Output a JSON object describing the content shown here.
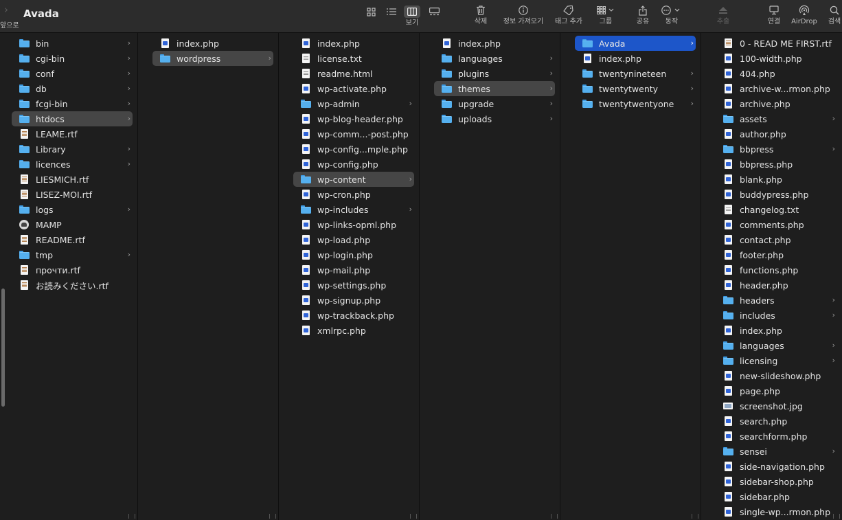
{
  "window": {
    "title": "Avada",
    "back_label": "앞으로"
  },
  "toolbar": {
    "view_label": "보기",
    "delete_label": "삭제",
    "info_label": "정보 가져오기",
    "tag_label": "태그 추가",
    "group_label": "그룹",
    "share_label": "공유",
    "action_label": "동작",
    "eject_label": "추출",
    "connect_label": "연결",
    "airdrop_label": "AirDrop",
    "search_label": "검색"
  },
  "columns": [
    {
      "items": [
        {
          "name": "bin",
          "type": "folder",
          "chevron": true
        },
        {
          "name": "cgi-bin",
          "type": "folder",
          "chevron": true
        },
        {
          "name": "conf",
          "type": "folder",
          "chevron": true
        },
        {
          "name": "db",
          "type": "folder",
          "chevron": true
        },
        {
          "name": "fcgi-bin",
          "type": "folder",
          "chevron": true
        },
        {
          "name": "htdocs",
          "type": "folder",
          "chevron": true,
          "selected": "gray"
        },
        {
          "name": "LEAME.rtf",
          "type": "rtf"
        },
        {
          "name": "Library",
          "type": "folder",
          "chevron": true
        },
        {
          "name": "licences",
          "type": "folder",
          "chevron": true
        },
        {
          "name": "LIESMICH.rtf",
          "type": "rtf"
        },
        {
          "name": "LISEZ-MOI.rtf",
          "type": "rtf"
        },
        {
          "name": "logs",
          "type": "folder",
          "chevron": true
        },
        {
          "name": "MAMP",
          "type": "app"
        },
        {
          "name": "README.rtf",
          "type": "rtf"
        },
        {
          "name": "tmp",
          "type": "folder",
          "chevron": true
        },
        {
          "name": "прочти.rtf",
          "type": "rtf"
        },
        {
          "name": "お読みください.rtf",
          "type": "rtf"
        }
      ]
    },
    {
      "items": [
        {
          "name": "index.php",
          "type": "php"
        },
        {
          "name": "wordpress",
          "type": "folder",
          "chevron": true,
          "selected": "gray"
        }
      ]
    },
    {
      "items": [
        {
          "name": "index.php",
          "type": "php"
        },
        {
          "name": "license.txt",
          "type": "txt"
        },
        {
          "name": "readme.html",
          "type": "html"
        },
        {
          "name": "wp-activate.php",
          "type": "php"
        },
        {
          "name": "wp-admin",
          "type": "folder",
          "chevron": true
        },
        {
          "name": "wp-blog-header.php",
          "type": "php"
        },
        {
          "name": "wp-comm...-post.php",
          "type": "php"
        },
        {
          "name": "wp-config...mple.php",
          "type": "php"
        },
        {
          "name": "wp-config.php",
          "type": "php"
        },
        {
          "name": "wp-content",
          "type": "folder",
          "chevron": true,
          "selected": "gray"
        },
        {
          "name": "wp-cron.php",
          "type": "php"
        },
        {
          "name": "wp-includes",
          "type": "folder",
          "chevron": true
        },
        {
          "name": "wp-links-opml.php",
          "type": "php"
        },
        {
          "name": "wp-load.php",
          "type": "php"
        },
        {
          "name": "wp-login.php",
          "type": "php"
        },
        {
          "name": "wp-mail.php",
          "type": "php"
        },
        {
          "name": "wp-settings.php",
          "type": "php"
        },
        {
          "name": "wp-signup.php",
          "type": "php"
        },
        {
          "name": "wp-trackback.php",
          "type": "php"
        },
        {
          "name": "xmlrpc.php",
          "type": "php"
        }
      ]
    },
    {
      "items": [
        {
          "name": "index.php",
          "type": "php"
        },
        {
          "name": "languages",
          "type": "folder",
          "chevron": true
        },
        {
          "name": "plugins",
          "type": "folder",
          "chevron": true
        },
        {
          "name": "themes",
          "type": "folder",
          "chevron": true,
          "selected": "gray"
        },
        {
          "name": "upgrade",
          "type": "folder",
          "chevron": true
        },
        {
          "name": "uploads",
          "type": "folder",
          "chevron": true
        }
      ]
    },
    {
      "items": [
        {
          "name": "Avada",
          "type": "folder",
          "chevron": true,
          "selected": "blue"
        },
        {
          "name": "index.php",
          "type": "php"
        },
        {
          "name": "twentynineteen",
          "type": "folder",
          "chevron": true
        },
        {
          "name": "twentytwenty",
          "type": "folder",
          "chevron": true
        },
        {
          "name": "twentytwentyone",
          "type": "folder",
          "chevron": true
        }
      ]
    },
    {
      "items": [
        {
          "name": "0 - READ ME FIRST.rtf",
          "type": "rtf"
        },
        {
          "name": "100-width.php",
          "type": "php"
        },
        {
          "name": "404.php",
          "type": "php"
        },
        {
          "name": "archive-w...rmon.php",
          "type": "php"
        },
        {
          "name": "archive.php",
          "type": "php"
        },
        {
          "name": "assets",
          "type": "folder",
          "chevron": true
        },
        {
          "name": "author.php",
          "type": "php"
        },
        {
          "name": "bbpress",
          "type": "folder",
          "chevron": true
        },
        {
          "name": "bbpress.php",
          "type": "php"
        },
        {
          "name": "blank.php",
          "type": "php"
        },
        {
          "name": "buddypress.php",
          "type": "php"
        },
        {
          "name": "changelog.txt",
          "type": "txt"
        },
        {
          "name": "comments.php",
          "type": "php"
        },
        {
          "name": "contact.php",
          "type": "php"
        },
        {
          "name": "footer.php",
          "type": "php"
        },
        {
          "name": "functions.php",
          "type": "php"
        },
        {
          "name": "header.php",
          "type": "php"
        },
        {
          "name": "headers",
          "type": "folder",
          "chevron": true
        },
        {
          "name": "includes",
          "type": "folder",
          "chevron": true
        },
        {
          "name": "index.php",
          "type": "php"
        },
        {
          "name": "languages",
          "type": "folder",
          "chevron": true
        },
        {
          "name": "licensing",
          "type": "folder",
          "chevron": true
        },
        {
          "name": "new-slideshow.php",
          "type": "php"
        },
        {
          "name": "page.php",
          "type": "php"
        },
        {
          "name": "screenshot.jpg",
          "type": "img"
        },
        {
          "name": "search.php",
          "type": "php"
        },
        {
          "name": "searchform.php",
          "type": "php"
        },
        {
          "name": "sensei",
          "type": "folder",
          "chevron": true
        },
        {
          "name": "side-navigation.php",
          "type": "php"
        },
        {
          "name": "sidebar-shop.php",
          "type": "php"
        },
        {
          "name": "sidebar.php",
          "type": "php"
        },
        {
          "name": "single-wp...rmon.php",
          "type": "php"
        }
      ]
    }
  ]
}
